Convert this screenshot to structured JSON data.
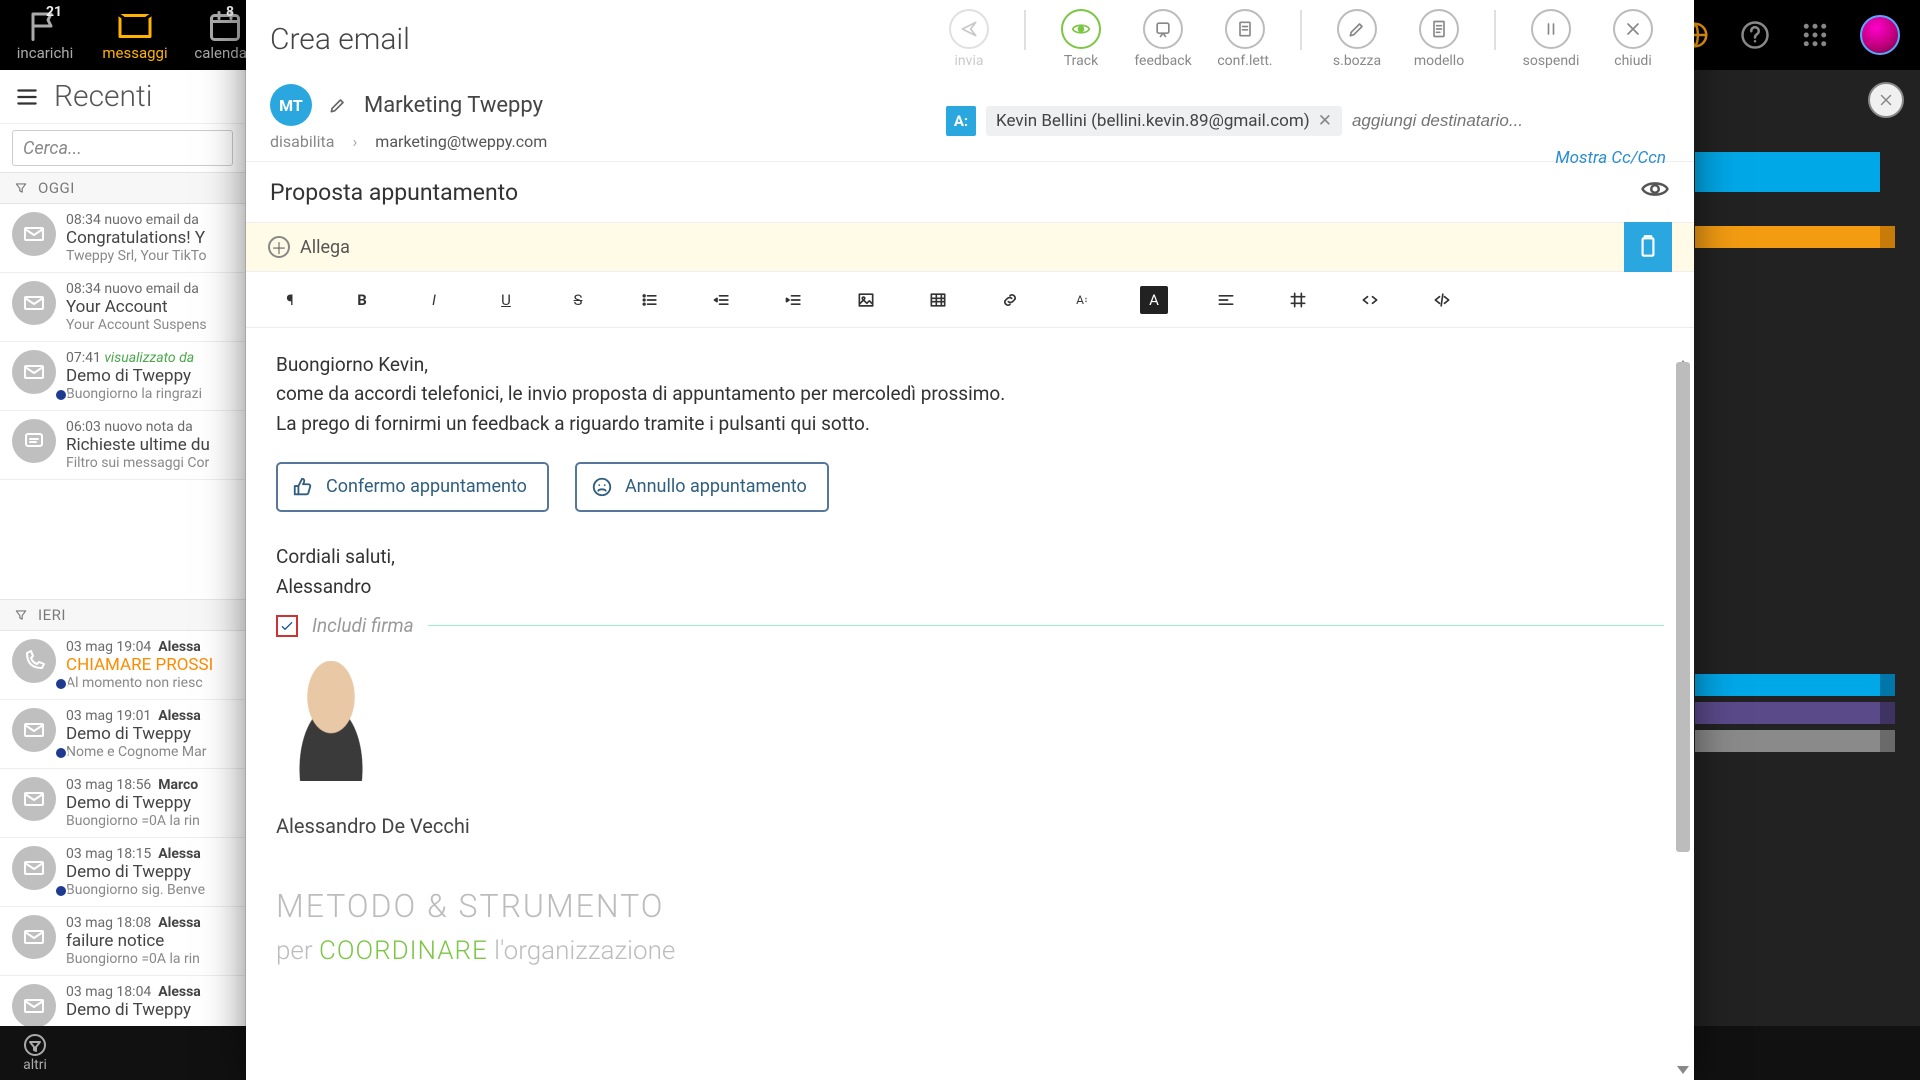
{
  "topnav": {
    "incarichi": {
      "label": "incarichi",
      "badge": "21"
    },
    "messaggi": {
      "label": "messaggi"
    },
    "calendario": {
      "label": "calendari",
      "badge": "8"
    }
  },
  "left_panel": {
    "title": "Recenti",
    "search_placeholder": "Cerca...",
    "section_today": "OGGI",
    "section_yesterday": "IERI",
    "items_today": [
      {
        "meta_time": "08:34",
        "meta_text": "nuovo email da",
        "subject": "Congratulations! Y",
        "preview": "Tweppy Srl, Your TikTo",
        "icon": "mail",
        "dot": false
      },
      {
        "meta_time": "08:34",
        "meta_text": "nuovo email da",
        "subject": "Your Account",
        "preview": "Your Account Suspens",
        "icon": "mail",
        "dot": false
      },
      {
        "meta_time": "07:41",
        "meta_text": "visualizzato da",
        "viz": true,
        "subject": "Demo di Tweppy",
        "preview": "Buongiorno la ringrazi",
        "icon": "mail",
        "dot": true
      },
      {
        "meta_time": "06:03",
        "meta_text": "nuovo nota da",
        "subject": "Richieste ultime du",
        "preview": "Filtro sui messaggi Cor",
        "icon": "chat",
        "dot": false
      }
    ],
    "items_yesterday": [
      {
        "meta_time": "03 mag 19:04",
        "sender": "Alessa",
        "subject": "CHIAMARE PROSSI",
        "hot": true,
        "preview": "Al momento non riesc",
        "icon": "phone",
        "dot": true
      },
      {
        "meta_time": "03 mag 19:01",
        "sender": "Alessa",
        "subject": "Demo di Tweppy",
        "preview": "Nome e Cognome Mar",
        "icon": "mail",
        "dot": true
      },
      {
        "meta_time": "03 mag 18:56",
        "sender": "Marco",
        "subject": "Demo di Tweppy",
        "preview": "Buongiorno =0A la rin",
        "icon": "mail",
        "dot": false
      },
      {
        "meta_time": "03 mag 18:15",
        "sender": "Alessa",
        "subject": "Demo di Tweppy",
        "preview": "Buongiorno sig. Benve",
        "icon": "mail",
        "dot": true
      },
      {
        "meta_time": "03 mag 18:08",
        "sender": "Alessa",
        "subject": "failure notice",
        "preview": "Buongiorno =0A la rin",
        "icon": "mail",
        "dot": false
      },
      {
        "meta_time": "03 mag 18:04",
        "sender": "Alessa",
        "subject": "Demo di Tweppy",
        "preview": "",
        "icon": "mail",
        "dot": false
      }
    ]
  },
  "bottom": {
    "altri": "altri"
  },
  "compose": {
    "title": "Crea email",
    "actions": {
      "invia": "invia",
      "track": "Track",
      "feedback": "feedback",
      "conflett": "conf.lett.",
      "sbozza": "s.bozza",
      "modello": "modello",
      "sospendi": "sospendi",
      "chiudi": "chiudi"
    },
    "from": {
      "avatar": "MT",
      "name": "Marketing Tweppy",
      "disable": "disabilita",
      "email": "marketing@tweppy.com"
    },
    "to": {
      "label": "A:",
      "chip": "Kevin Bellini (bellini.kevin.89@gmail.com)",
      "add_placeholder": "aggiungi destinatario...",
      "cc": "Mostra Cc/Ccn"
    },
    "subject": "Proposta appuntamento",
    "attach": "Allega",
    "body": {
      "line1": "Buongiorno Kevin,",
      "line2": "come da accordi telefonici, le invio proposta di appuntamento per mercoledì prossimo.",
      "line3": "La prego di fornirmi un feedback a riguardo tramite i pulsanti qui sotto.",
      "btn_confirm": "Confermo appuntamento",
      "btn_cancel": "Annullo appuntamento",
      "line4": "Cordiali saluti,",
      "line5": "Alessandro"
    },
    "signature": {
      "include": "Includi firma",
      "name": "Alessandro De Vecchi",
      "tag1": "METODO & STRUMENTO",
      "tag2_pre": "per ",
      "tag2_em": "COORDINARE",
      "tag2_post": " l'organizzazione"
    }
  }
}
